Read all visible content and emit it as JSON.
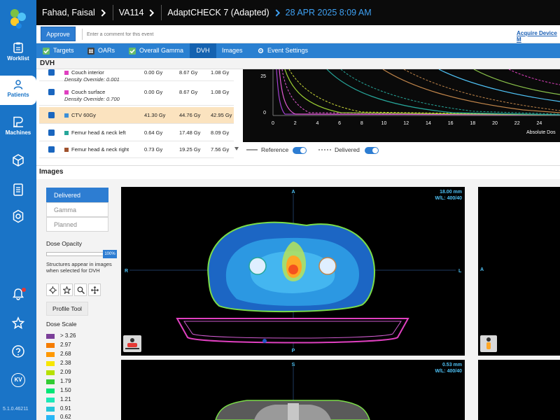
{
  "sidebar": {
    "items": [
      {
        "label": "Worklist",
        "icon": "clipboard-icon"
      },
      {
        "label": "Patients",
        "icon": "person-icon",
        "active": true
      },
      {
        "label": "Machines",
        "icon": "machine-icon"
      }
    ],
    "avatar_initials": "KV",
    "version": "5.1.0.46211"
  },
  "header": {
    "patient_name": "Fahad, Faisal",
    "machine": "VA114",
    "plan": "AdaptCHECK 7 (Adapted)",
    "datetime": "28 APR 2025 8:09 AM"
  },
  "approve_bar": {
    "approve_label": "Approve",
    "comment_placeholder": "Enter a comment for this event",
    "acquire_link": "Acquire Device M"
  },
  "tabs": {
    "targets": "Targets",
    "oars": "OARs",
    "gamma": "Overall Gamma",
    "dvh": "DVH",
    "images": "Images",
    "event_settings": "Event Settings"
  },
  "dvh": {
    "section_title": "DVH",
    "structures": [
      {
        "name": "Couch interior",
        "density": "Density Override: 0.001",
        "v1": "0.00 Gy",
        "v2": "8.67 Gy",
        "v3": "1.08 Gy",
        "color": "#e040c0"
      },
      {
        "name": "Couch surface",
        "density": "Density Override: 0.700",
        "v1": "0.00 Gy",
        "v2": "8.67 Gy",
        "v3": "1.08 Gy",
        "color": "#e040c0"
      },
      {
        "name": "CTV 60Gy",
        "density": "",
        "v1": "41.30 Gy",
        "v2": "44.76 Gy",
        "v3": "42.95 Gy",
        "color": "#3b8fd8"
      },
      {
        "name": "Femur head & neck left",
        "density": "",
        "v1": "0.64 Gy",
        "v2": "17.48 Gy",
        "v3": "8.09 Gy",
        "color": "#26a69a"
      },
      {
        "name": "Femur head & neck right",
        "density": "",
        "v1": "0.73 Gy",
        "v2": "19.25 Gy",
        "v3": "7.56 Gy",
        "color": "#a0522d"
      }
    ],
    "legend_reference": "Reference",
    "legend_delivered": "Delivered",
    "graph": {
      "y_ticks": [
        "25",
        "0"
      ],
      "x_ticks": [
        "0",
        "2",
        "4",
        "6",
        "8",
        "10",
        "12",
        "14",
        "16",
        "18",
        "20",
        "22",
        "24"
      ],
      "x_label": "Absolute Dos"
    }
  },
  "images": {
    "section_title": "Images",
    "modes": [
      "Delivered",
      "Gamma",
      "Planned"
    ],
    "dose_opacity_label": "Dose Opacity",
    "dose_opacity_value": "100%",
    "structures_note": "Structures appear in images when selected for DVH",
    "profile_tool": "Profile Tool",
    "dose_scale_label": "Dose Scale",
    "dose_scale": [
      {
        "label": "> 3.26",
        "color": "#7b3f99"
      },
      {
        "label": "2.97",
        "color": "#f57c00"
      },
      {
        "label": "2.68",
        "color": "#ff9800"
      },
      {
        "label": "2.38",
        "color": "#f7e600"
      },
      {
        "label": "2.09",
        "color": "#b7e100"
      },
      {
        "label": "1.79",
        "color": "#33cc33"
      },
      {
        "label": "1.50",
        "color": "#00e676"
      },
      {
        "label": "1.21",
        "color": "#1de9b6"
      },
      {
        "label": "0.91",
        "color": "#26c6da"
      },
      {
        "label": "0.62",
        "color": "#29b6f6"
      }
    ],
    "axial": {
      "top": "A",
      "bottom": "P",
      "left": "R",
      "right": "L",
      "slice": "18.00 mm",
      "wl": "W/L: 400/40"
    },
    "coronal": {
      "top": "S",
      "slice": "0.53 mm",
      "wl": "W/L: 400/40"
    },
    "sagittal": {
      "left": "A"
    }
  }
}
